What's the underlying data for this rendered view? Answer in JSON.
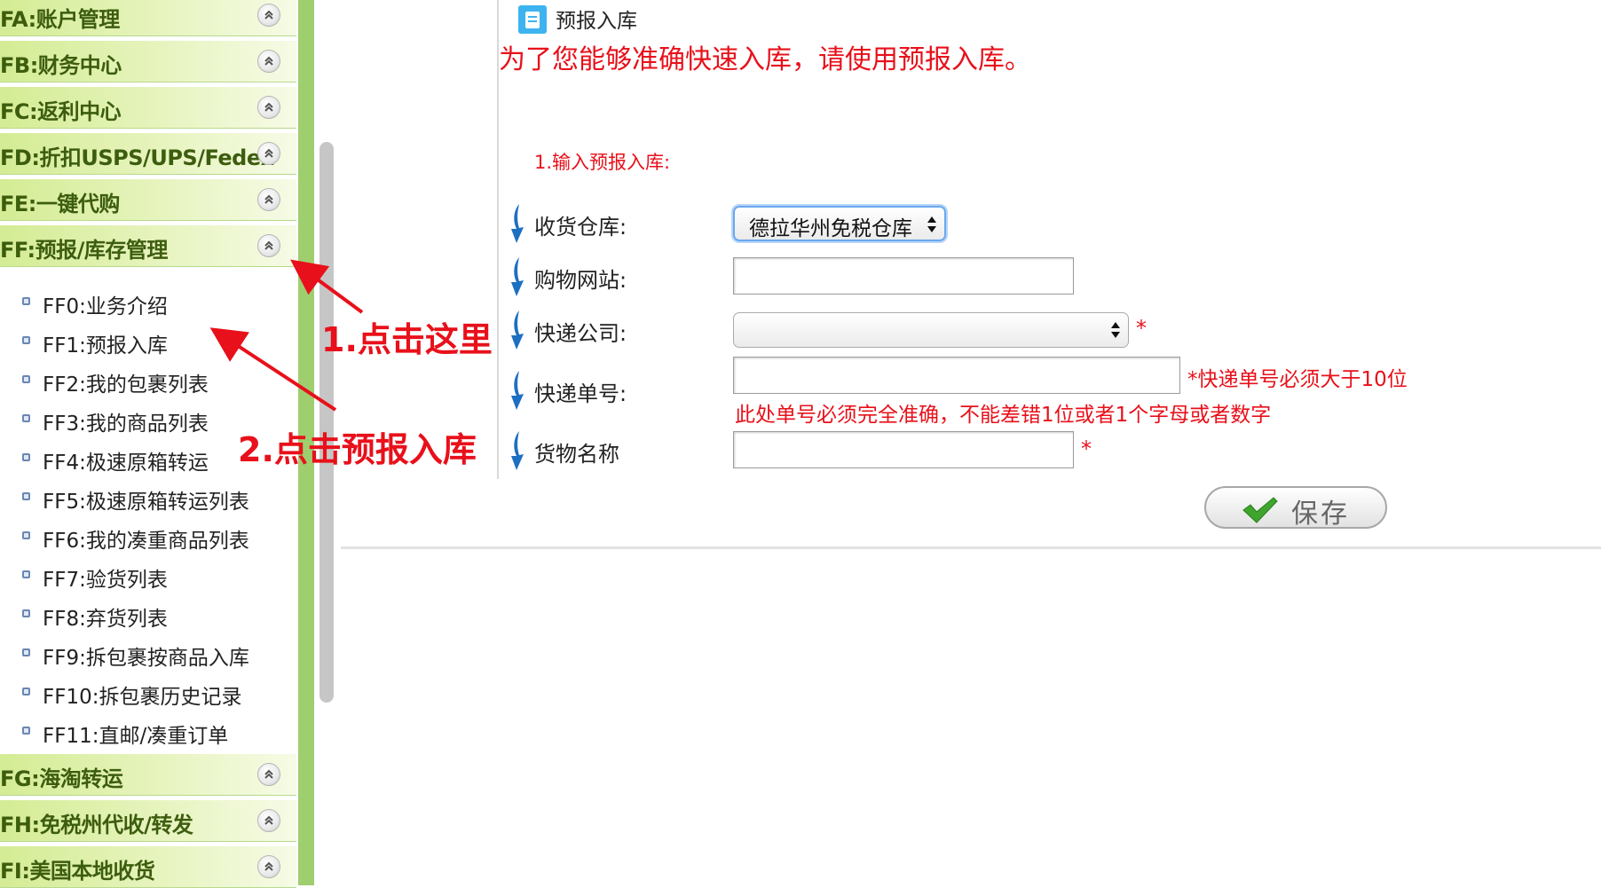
{
  "sidebar": {
    "sections_top": [
      {
        "label": "FA:账户管理"
      },
      {
        "label": "FB:财务中心"
      },
      {
        "label": "FC:返利中心"
      },
      {
        "label": "FD:折扣USPS/UPS/Fedex"
      },
      {
        "label": "FE:一键代购"
      },
      {
        "label": "FF:预报/库存管理"
      }
    ],
    "sub_items": [
      {
        "label": "FF0:业务介绍"
      },
      {
        "label": "FF1:预报入库"
      },
      {
        "label": "FF2:我的包裹列表"
      },
      {
        "label": "FF3:我的商品列表"
      },
      {
        "label": "FF4:极速原箱转运"
      },
      {
        "label": "FF5:极速原箱转运列表"
      },
      {
        "label": "FF6:我的凑重商品列表"
      },
      {
        "label": "FF7:验货列表"
      },
      {
        "label": "FF8:弃货列表"
      },
      {
        "label": "FF9:拆包裹按商品入库"
      },
      {
        "label": "FF10:拆包裹历史记录"
      },
      {
        "label": "FF11:直邮/凑重订单"
      }
    ],
    "sections_bottom": [
      {
        "label": "FG:海淘转运"
      },
      {
        "label": "FH:免税州代收/转发"
      },
      {
        "label": "FI:美国本地收货"
      }
    ]
  },
  "main": {
    "title": "预报入库",
    "notice": "为了您能够准确快速入库，请使用预报入库。",
    "step_label": "1.输入预报入库:",
    "fields": {
      "warehouse": {
        "label": "收货仓库:",
        "value": "德拉华州免税仓库"
      },
      "website": {
        "label": "购物网站:",
        "value": ""
      },
      "courier": {
        "label": "快递公司:",
        "value": "",
        "required": "*"
      },
      "tracking": {
        "label": "快递单号:",
        "value": "",
        "hint": "*快递单号必须大于10位",
        "note": "此处单号必须完全准确，不能差错1位或者1个字母或者数字"
      },
      "goods": {
        "label": "货物名称",
        "value": "",
        "required": "*"
      }
    },
    "save_label": "保存"
  },
  "annotations": {
    "step1": "1.点击这里",
    "step2": "2.点击预报入库"
  },
  "colors": {
    "sidebar_green": "#9fce6f",
    "section_text": "#3d5d0e",
    "alert_red": "#e8101a",
    "title_icon_blue": "#3db4f0"
  }
}
